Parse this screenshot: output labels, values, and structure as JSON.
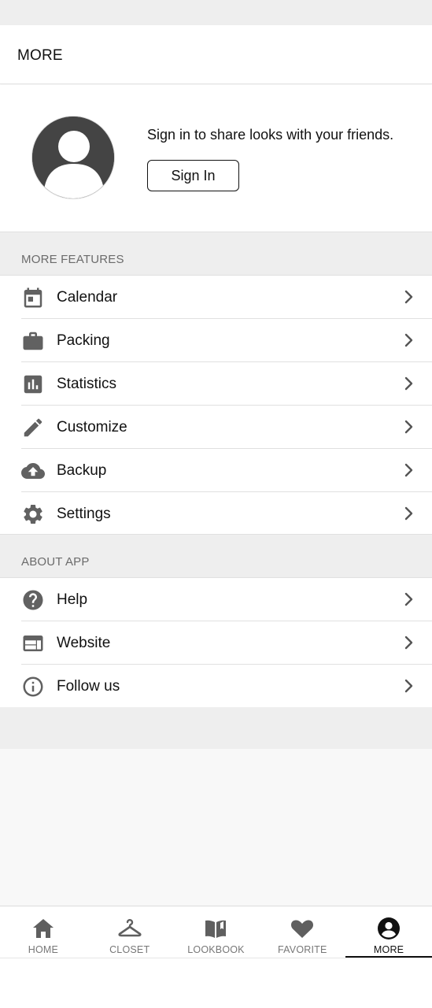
{
  "header": {
    "title": "MORE"
  },
  "profile": {
    "message": "Sign in to share looks with your friends.",
    "signin_label": "Sign In"
  },
  "features": {
    "title": "MORE FEATURES",
    "items": [
      {
        "label": "Calendar",
        "icon": "calendar-icon"
      },
      {
        "label": "Packing",
        "icon": "briefcase-icon"
      },
      {
        "label": "Statistics",
        "icon": "bar-chart-icon"
      },
      {
        "label": "Customize",
        "icon": "pencil-icon"
      },
      {
        "label": "Backup",
        "icon": "cloud-upload-icon"
      },
      {
        "label": "Settings",
        "icon": "gear-icon"
      }
    ]
  },
  "about": {
    "title": "ABOUT APP",
    "items": [
      {
        "label": "Help",
        "icon": "help-icon"
      },
      {
        "label": "Website",
        "icon": "web-icon"
      },
      {
        "label": "Follow us",
        "icon": "info-icon"
      }
    ]
  },
  "bottom_nav": {
    "items": [
      {
        "label": "HOME",
        "icon": "home-icon"
      },
      {
        "label": "CLOSET",
        "icon": "hanger-icon"
      },
      {
        "label": "LOOKBOOK",
        "icon": "book-icon"
      },
      {
        "label": "FAVORITE",
        "icon": "heart-icon"
      },
      {
        "label": "MORE",
        "icon": "account-circle-icon"
      }
    ],
    "active": "MORE"
  },
  "colors": {
    "icon_gray": "#616161",
    "section_bg": "#eeeeee",
    "divider": "#e0e0e0",
    "text": "#111111",
    "muted": "#6b6b6b"
  }
}
